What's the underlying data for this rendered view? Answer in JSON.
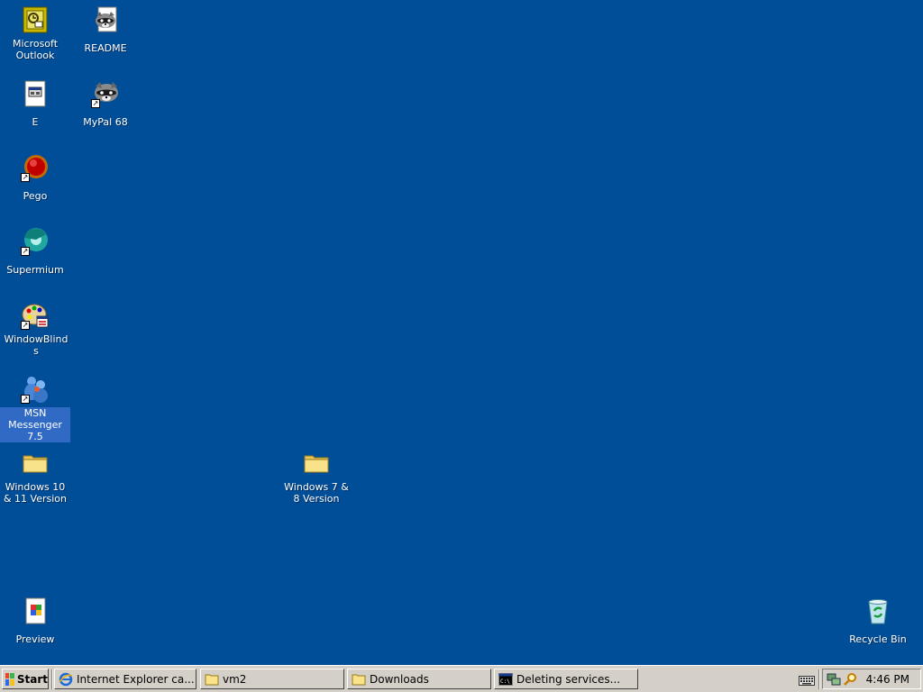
{
  "desktop": {
    "icons": [
      {
        "label": "Microsoft Outlook",
        "icon": "outlook-icon"
      },
      {
        "label": "README",
        "icon": "raccoon-document-icon"
      },
      {
        "label": "E",
        "icon": "application-window-icon"
      },
      {
        "label": "MyPal 68",
        "icon": "raccoon-icon"
      },
      {
        "label": "Pego",
        "icon": "red-ball-icon"
      },
      {
        "label": "Supermium",
        "icon": "supermium-icon"
      },
      {
        "label": "WindowBlinds",
        "icon": "palette-icon"
      },
      {
        "label": "MSN Messenger 7.5",
        "icon": "msn-people-icon"
      },
      {
        "label": "Windows 10 & 11 Version",
        "icon": "folder-icon"
      },
      {
        "label": "Windows 7 & 8 Version",
        "icon": "folder-icon"
      },
      {
        "label": "Preview",
        "icon": "preview-document-icon"
      },
      {
        "label": "Recycle Bin",
        "icon": "recycle-bin-icon"
      }
    ]
  },
  "taskbar": {
    "start_label": "Start",
    "tasks": [
      {
        "label": "Internet Explorer ca...",
        "icon": "internet-explorer-icon"
      },
      {
        "label": "vm2",
        "icon": "folder-icon"
      },
      {
        "label": "Downloads",
        "icon": "folder-icon"
      },
      {
        "label": "Deleting services...",
        "icon": "command-prompt-icon"
      }
    ],
    "clock": "4:46 PM"
  },
  "colors": {
    "desktop_background": "#004e98",
    "taskbar": "#d4d0c8",
    "selection": "#316ac5"
  }
}
